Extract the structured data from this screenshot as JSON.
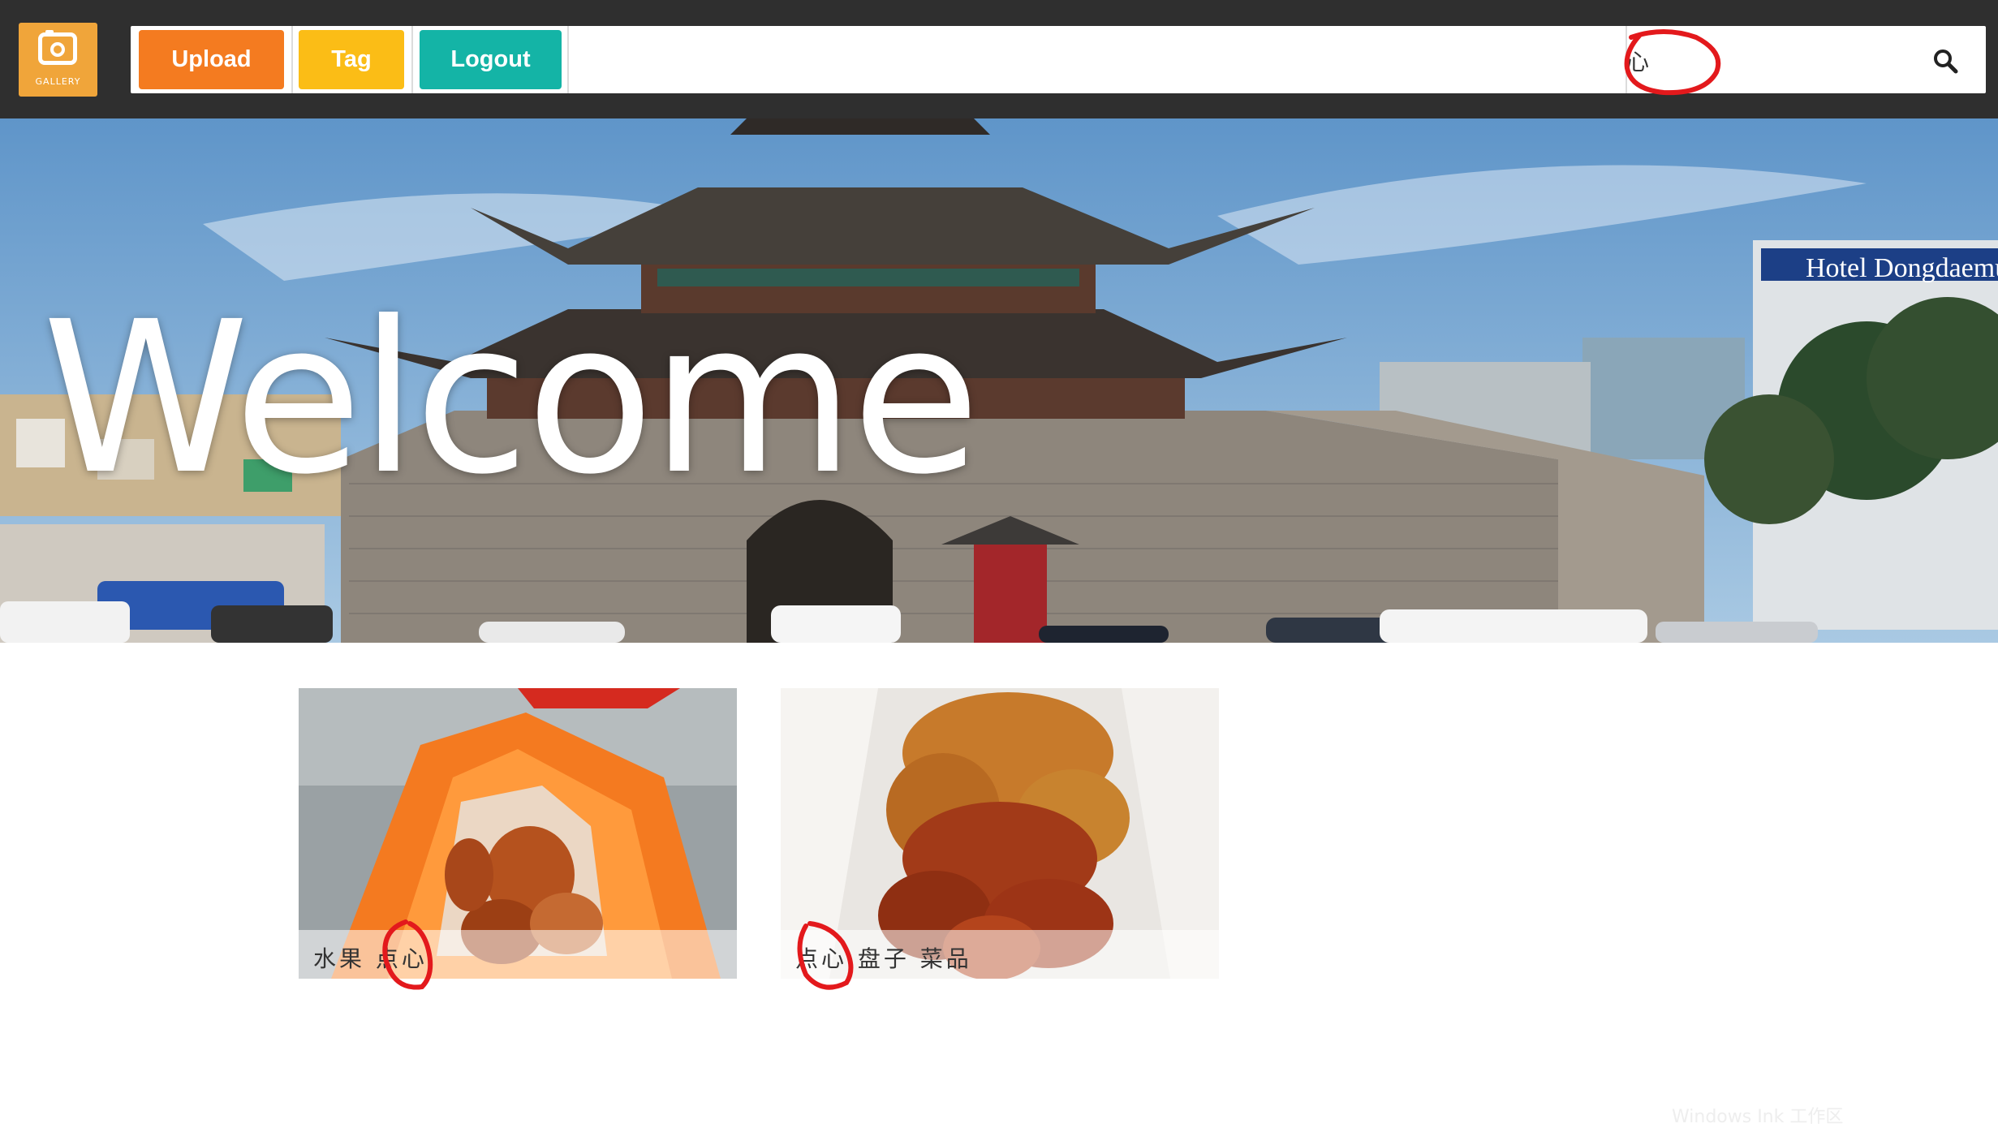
{
  "header": {
    "logo_text": "GALLERY",
    "buttons": {
      "upload": "Upload",
      "tag": "Tag",
      "logout": "Logout"
    },
    "search": {
      "value": "心",
      "icon": "search-icon"
    }
  },
  "hero": {
    "title": "Welcome",
    "sign_text": "Hotel Dongdaemun"
  },
  "gallery": {
    "cards": [
      {
        "caption": "水果 点心"
      },
      {
        "caption": "点心 盘子 菜品"
      }
    ]
  },
  "watermark": "Windows Ink 工作区",
  "colors": {
    "topbar": "#2f2f2f",
    "upload": "#f47b20",
    "tag": "#fbbd16",
    "logout": "#14b4a6",
    "logo": "#f0a53a",
    "ink_annotation": "#e3191c"
  }
}
